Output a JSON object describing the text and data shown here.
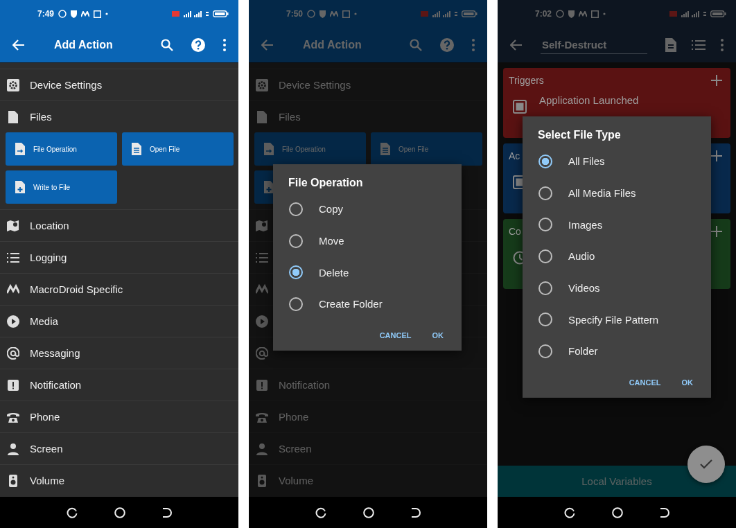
{
  "phones": [
    {
      "kind": "action_list",
      "status_bar": {
        "time": "7:49"
      },
      "app_bar": {
        "title": "Add Action"
      },
      "categories": [
        {
          "label": "Device Settings"
        },
        {
          "label": "Files",
          "children": [
            {
              "label": "File Operation"
            },
            {
              "label": "Open File"
            },
            {
              "label": "Write to File"
            }
          ]
        },
        {
          "label": "Location"
        },
        {
          "label": "Logging"
        },
        {
          "label": "MacroDroid Specific"
        },
        {
          "label": "Media"
        },
        {
          "label": "Messaging"
        },
        {
          "label": "Notification"
        },
        {
          "label": "Phone"
        },
        {
          "label": "Screen"
        },
        {
          "label": "Volume"
        }
      ]
    },
    {
      "kind": "action_list",
      "status_bar": {
        "time": "7:50"
      },
      "app_bar": {
        "title": "Add Action"
      },
      "categories": [
        {
          "label": "Device Settings"
        },
        {
          "label": "Files",
          "children": [
            {
              "label": "File Operation"
            },
            {
              "label": "Open File"
            },
            {
              "covered": true
            }
          ]
        },
        {
          "covered": true
        },
        {
          "covered": true
        },
        {
          "covered": true
        },
        {
          "covered": true
        },
        {
          "covered": true
        },
        {
          "label": "Notification"
        },
        {
          "label": "Phone"
        },
        {
          "label": "Screen"
        },
        {
          "label": "Volume"
        }
      ],
      "dialog": {
        "title": "File Operation",
        "options": [
          {
            "label": "Copy",
            "selected": false
          },
          {
            "label": "Move",
            "selected": false
          },
          {
            "label": "Delete",
            "selected": true
          },
          {
            "label": "Create Folder",
            "selected": false
          }
        ],
        "buttons": [
          "CANCEL",
          "OK"
        ]
      }
    },
    {
      "kind": "macro_editor",
      "status_bar": {
        "time": "7:02"
      },
      "app_bar": {
        "title": "Self-Destruct"
      },
      "sections": [
        {
          "label": "Triggers",
          "color": "#5a1212",
          "items": [
            {
              "label": "Application Launched"
            }
          ]
        },
        {
          "label": "Ac",
          "color": "#08294c",
          "items": [
            {
              "covered": true
            }
          ]
        },
        {
          "label": "Co",
          "color": "#163b1a",
          "items": [
            {
              "covered": true
            }
          ]
        }
      ],
      "footer": {
        "label": "Local Variables"
      },
      "dialog": {
        "title": "Select File Type",
        "options": [
          {
            "label": "All Files",
            "selected": true
          },
          {
            "label": "All Media Files",
            "selected": false
          },
          {
            "label": "Images",
            "selected": false
          },
          {
            "label": "Audio",
            "selected": false
          },
          {
            "label": "Videos",
            "selected": false
          },
          {
            "label": "Specify File Pattern",
            "selected": false
          },
          {
            "label": "Folder",
            "selected": false
          }
        ],
        "buttons": [
          "CANCEL",
          "OK"
        ]
      }
    }
  ]
}
